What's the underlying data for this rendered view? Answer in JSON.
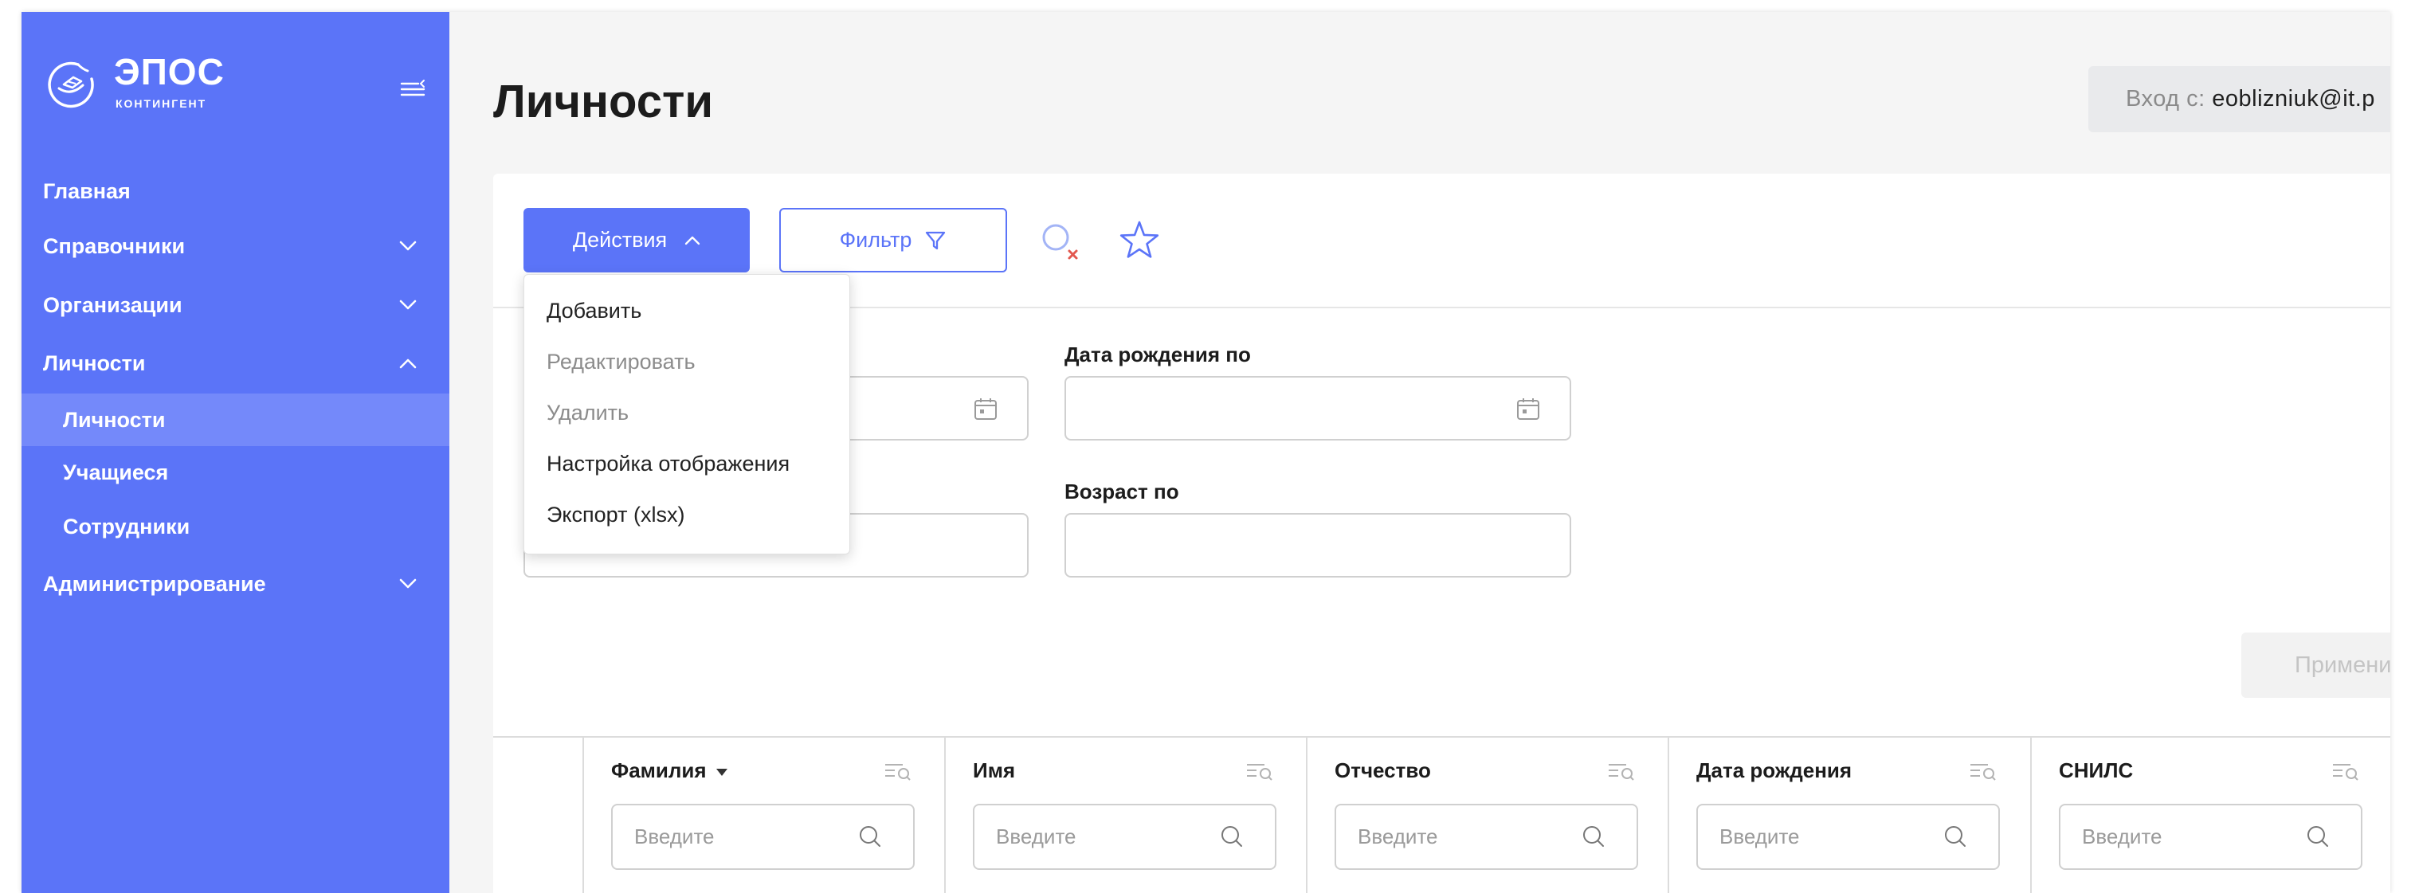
{
  "colors": {
    "accent": "#5b74f8",
    "sidebar_active": "#7489fa",
    "main_bg": "#f5f5f5",
    "clear_mark": "#e2584f"
  },
  "sidebar": {
    "logo": {
      "title": "ЭПОС",
      "subtitle": "КОНТИНГЕНТ",
      "icon": "epos-logo-icon"
    },
    "collapse_icon": "menu-collapse-icon",
    "items": [
      {
        "label": "Главная"
      },
      {
        "label": "Справочники",
        "chevron": "down"
      },
      {
        "label": "Организации",
        "chevron": "down"
      },
      {
        "label": "Личности",
        "chevron": "up",
        "children": [
          {
            "label": "Личности",
            "active": true
          },
          {
            "label": "Учащиеся"
          },
          {
            "label": "Сотрудники"
          }
        ]
      },
      {
        "label": "Администрирование",
        "chevron": "down"
      }
    ]
  },
  "header": {
    "title": "Личности",
    "login": {
      "prefix": "Вход с:",
      "user": "eoblizniuk@it.p"
    }
  },
  "toolbar": {
    "actions_label": "Действия",
    "actions_open": true,
    "filter_label": "Фильтр",
    "icons": [
      "search-clear-icon",
      "star-icon",
      "filter-funnel-icon"
    ]
  },
  "actions_menu": [
    {
      "label": "Добавить"
    },
    {
      "label": "Редактировать",
      "disabled": true
    },
    {
      "label": "Удалить",
      "disabled": true
    },
    {
      "label": "Настройка отображения"
    },
    {
      "label": "Экспорт (xlsx)"
    }
  ],
  "filters": {
    "row1": [
      {
        "value": "",
        "icon": "calendar-icon"
      },
      {
        "label": "Дата рождения по",
        "value": "",
        "icon": "calendar-icon"
      }
    ],
    "row2": [
      {
        "value": ""
      },
      {
        "label": "Возраст по",
        "value": ""
      }
    ],
    "apply_label": "Примени"
  },
  "table": {
    "columns": [
      {
        "label": "Фамилия",
        "sort": "desc"
      },
      {
        "label": "Имя"
      },
      {
        "label": "Отчество"
      },
      {
        "label": "Дата рождения"
      },
      {
        "label": "СНИЛС"
      }
    ],
    "search_placeholder": "Введите"
  }
}
